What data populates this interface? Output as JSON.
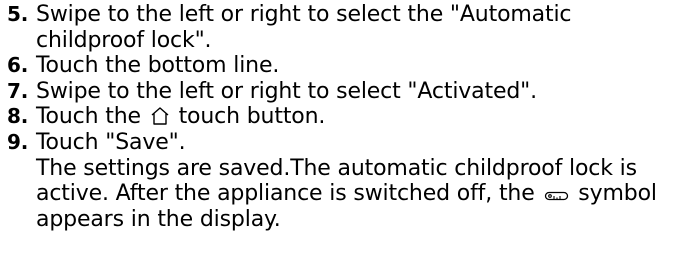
{
  "steps": [
    {
      "number": "5.",
      "text": "Swipe to the left or right to select the \"Automatic childproof lock\"."
    },
    {
      "number": "6.",
      "text": "Touch the bottom line."
    },
    {
      "number": "7.",
      "text": "Swipe to the left or right to select \"Activated\"."
    },
    {
      "number": "8.",
      "text_before": "Touch the",
      "icon": "home-icon",
      "text_after": "touch button."
    },
    {
      "number": "9.",
      "text": "Touch \"Save\".",
      "result_before": "The settings are saved.The automatic childproof lock is active. After the appliance is switched off, the",
      "result_icon": "key-icon",
      "result_after": "symbol appears in the display."
    }
  ]
}
